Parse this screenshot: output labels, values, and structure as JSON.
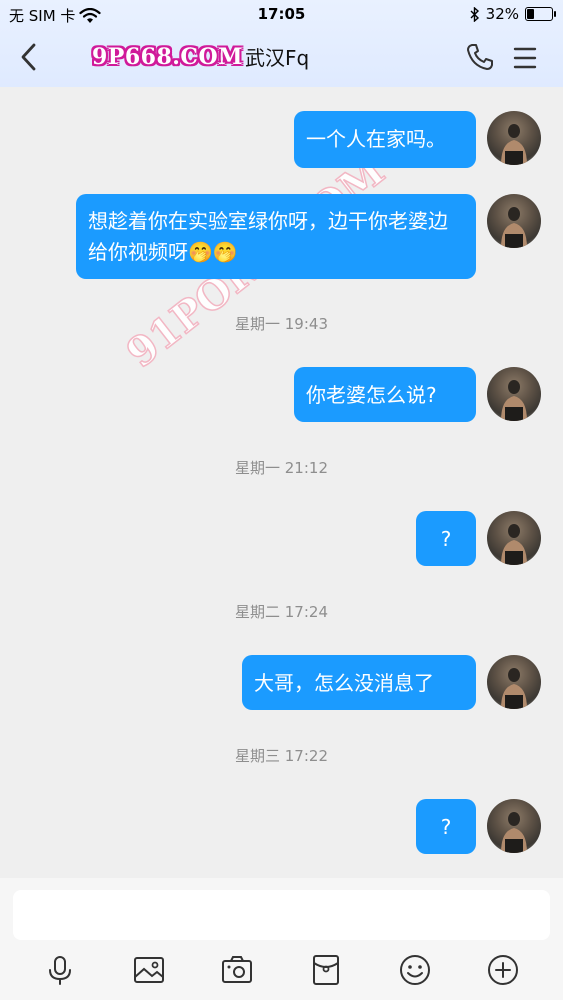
{
  "status_bar": {
    "carrier": "无 SIM 卡",
    "time": "17:05",
    "battery_percent": "32%",
    "battery_level": 0.32,
    "icons": [
      "wifi-icon",
      "bluetooth-icon",
      "battery-icon"
    ]
  },
  "header": {
    "site_text": "9P668.COM",
    "contact_name": "武汉Fq",
    "icons": [
      "back-chevron-icon",
      "phone-icon",
      "menu-icon"
    ]
  },
  "watermark": {
    "text": "91PORN.COM"
  },
  "colors": {
    "bubble": "#1b9bff",
    "header_bg": "#e3edff",
    "chat_bg": "#efefef"
  },
  "messages": [
    {
      "text": "一个人在家吗。"
    },
    {
      "text": "想趁着你在实验室绿你呀，边干你老婆边给你视频呀🤭🤭"
    },
    {
      "text": "你老婆怎么说?"
    },
    {
      "text": "?"
    },
    {
      "text": "大哥，怎么没消息了"
    },
    {
      "text": "?"
    }
  ],
  "timestamps": [
    "星期一 19:43",
    "星期一 21:12",
    "星期二 17:24",
    "星期三 17:22"
  ],
  "composer": {
    "input_value": "",
    "tools": [
      "microphone-icon",
      "image-icon",
      "camera-icon",
      "red-packet-icon",
      "emoji-icon",
      "plus-icon"
    ]
  }
}
